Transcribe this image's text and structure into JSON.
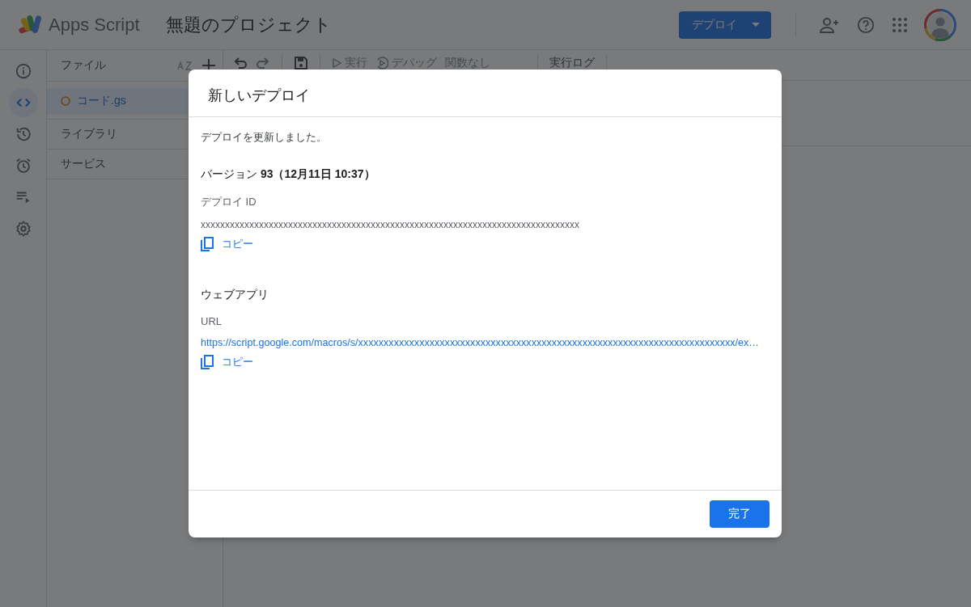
{
  "header": {
    "product": "Apps Script",
    "project_title": "無題のプロジェクト",
    "deploy_button": "デプロイ"
  },
  "rail": [
    {
      "kind": "info",
      "selected": false
    },
    {
      "kind": "code",
      "selected": true
    },
    {
      "kind": "history",
      "selected": false
    },
    {
      "kind": "alarm",
      "selected": false
    },
    {
      "kind": "runs",
      "selected": false
    },
    {
      "kind": "settings",
      "selected": false
    }
  ],
  "files": {
    "title": "ファイル",
    "items": [
      {
        "name": "コード.gs",
        "selected": true
      }
    ],
    "sections": [
      "ライブラリ",
      "サービス"
    ]
  },
  "toolbar": [
    {
      "kind": "undo",
      "disabled": false
    },
    {
      "kind": "redo",
      "disabled": true
    },
    {
      "kind": "save",
      "disabled": false
    },
    {
      "kind": "run",
      "label": "実行",
      "disabled": true
    },
    {
      "kind": "debug",
      "label": "デバッグ",
      "disabled": true
    },
    {
      "kind": "function",
      "label": "関数なし",
      "disabled": true
    },
    {
      "kind": "log",
      "label": "実行ログ",
      "disabled": false
    }
  ],
  "dialog": {
    "title": "新しいデプロイ",
    "message": "デプロイを更新しました。",
    "version": "バージョン **93（12月11日 10:37）**",
    "deploy_id_label": "デプロイ ID",
    "deploy_id": "xxxxxxxxxxxxxxxxxxxxxxxxxxxxxxxxxxxxxxxxxxxxxxxxxxxxxxxxxxxxxxxxxxxxxxxxxxxxxx",
    "copy_1": "コピー",
    "web_app_heading": "ウェブアプリ",
    "url_label": "URL",
    "url": "https://script.google.com/macros/s/xxxxxxxxxxxxxxxxxxxxxxxxxxxxxxxxxxxxxxxxxxxxxxxxxxxxxxxxxxxxxxxxxxxxxxxxxx/ex…",
    "copy_2": "コピー",
    "done_button": "完了"
  }
}
